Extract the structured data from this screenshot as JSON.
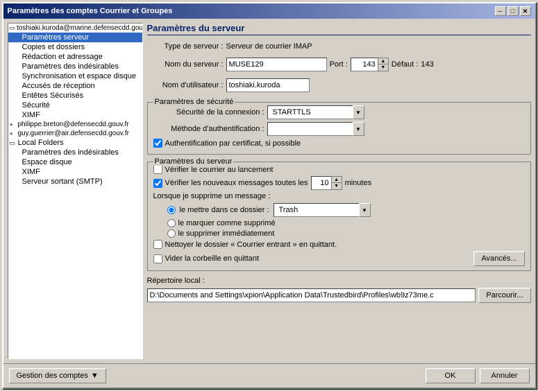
{
  "dialog": {
    "title": "Paramètres des comptes Courrier et Groupes",
    "close_label": "✕",
    "minimize_label": "─",
    "maximize_label": "□"
  },
  "left_panel": {
    "accounts": [
      {
        "id": "toshiaki",
        "label": "toshiaki.kuroda@marine.defensecdd.gouv.fr",
        "expanded": true,
        "children": [
          {
            "id": "parametres-serveur",
            "label": "Paramètres serveur",
            "selected": true
          },
          {
            "id": "copies-dossiers",
            "label": "Copies et dossiers"
          },
          {
            "id": "redaction",
            "label": "Rédaction et adressage"
          },
          {
            "id": "indesirables",
            "label": "Paramètres des indésirables"
          },
          {
            "id": "synchro",
            "label": "Synchronisation et espace disque"
          },
          {
            "id": "accuses",
            "label": "Accusés de réception"
          },
          {
            "id": "entetes",
            "label": "Entêtes Sécurisés"
          },
          {
            "id": "securite",
            "label": "Sécurité"
          },
          {
            "id": "ximf",
            "label": "XIMF"
          }
        ]
      },
      {
        "id": "philippe",
        "label": "philippe.breton@defensecdd.gouv.fr",
        "expanded": false,
        "children": []
      },
      {
        "id": "guy",
        "label": "guy.guerrier@air.defensecdd.gouv.fr",
        "expanded": false,
        "children": []
      },
      {
        "id": "local",
        "label": "Local Folders",
        "expanded": true,
        "children": [
          {
            "id": "local-indesirables",
            "label": "Paramètres des indésirables"
          },
          {
            "id": "local-espace",
            "label": "Espace disque"
          },
          {
            "id": "local-ximf",
            "label": "XIMF"
          },
          {
            "id": "local-smtp",
            "label": "Serveur sortant (SMTP)"
          }
        ]
      }
    ],
    "manage_accounts": "Gestion des comptes"
  },
  "right_panel": {
    "section_title": "Paramètres du serveur",
    "server_type_label": "Type de serveur :",
    "server_type_value": "Serveur de courrier IMAP",
    "server_name_label": "Nom du serveur :",
    "server_name_value": "MUSE129",
    "port_label": "Port :",
    "port_value": "143",
    "default_label": "Défaut :",
    "default_value": "143",
    "username_label": "Nom d'utilisateur :",
    "username_value": "toshiaki.kuroda",
    "security_group": "Paramètres de sécurité",
    "connection_security_label": "Sécurité de la connexion :",
    "connection_security_value": "STARTTLS",
    "auth_method_label": "Méthode d'authentification :",
    "auth_method_value": "",
    "cert_auth_label": "Authentification par certificat, si possible",
    "cert_auth_checked": true,
    "server_params_group": "Paramètres du serveur",
    "check_launch_label": "Vérifier le courrier au lancement",
    "check_launch_checked": false,
    "check_new_label": "Vérifier les nouveaux messages toutes les",
    "check_new_checked": true,
    "check_new_minutes": "10",
    "minutes_label": "minutes",
    "delete_message_label": "Lorsque je supprime un message :",
    "move_to_folder_label": "le mettre dans ce dossier :",
    "move_to_folder_value": "Trash",
    "mark_deleted_label": "le marquer comme supprimé",
    "delete_immediately_label": "le supprimer immédiatement",
    "clean_inbox_label": "Nettoyer le dossier « Courrier entrant » en quittant.",
    "clean_inbox_checked": false,
    "empty_trash_label": "Vider la corbeille en quittant",
    "empty_trash_checked": false,
    "advanced_button": "Avancés...",
    "local_dir_label": "Répertoire local :",
    "local_dir_value": "D:\\Documents and Settings\\xpion\\Application Data\\Trustedbird\\Profiles\\wb9z73me.c",
    "browse_button": "Parcourir...",
    "ok_button": "OK",
    "cancel_button": "Annuler"
  }
}
